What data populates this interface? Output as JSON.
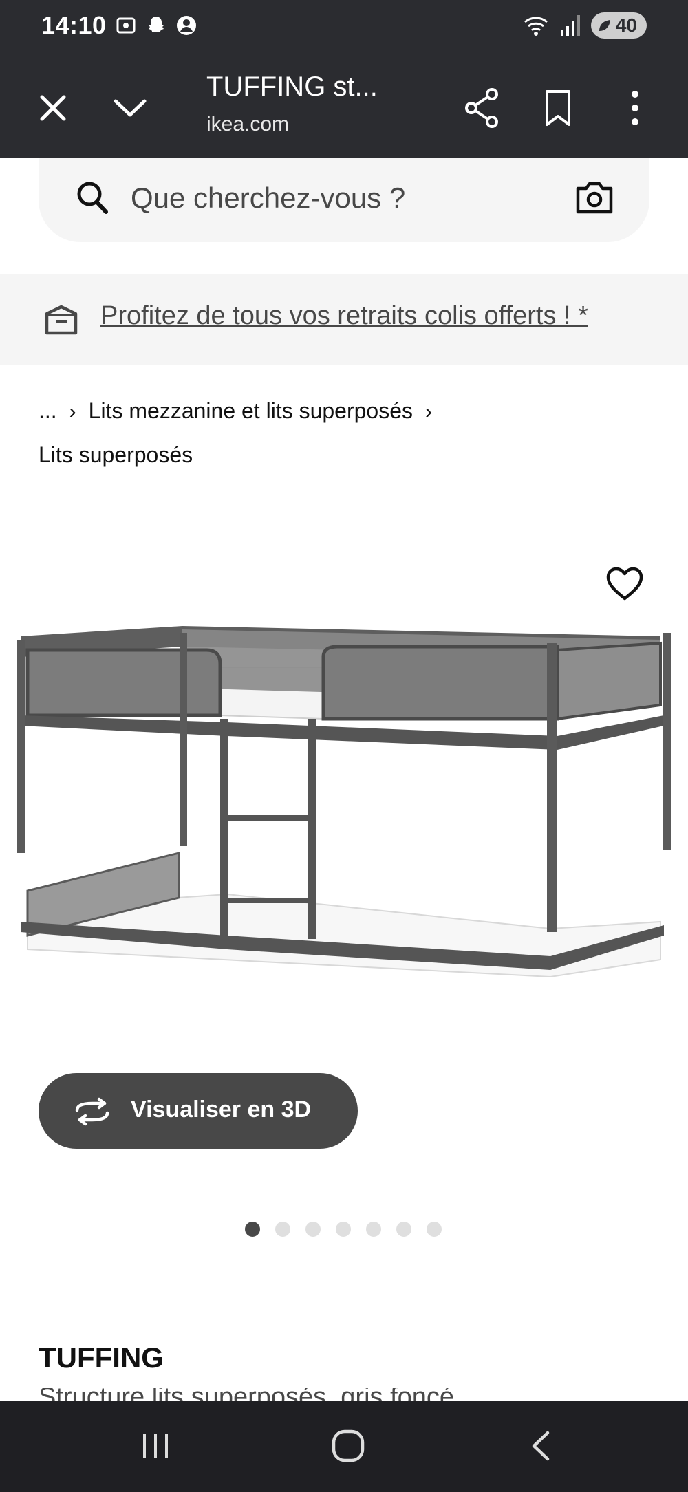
{
  "status_bar": {
    "time": "14:10",
    "battery": "40",
    "icons_left": [
      "screen-record-icon",
      "snapchat-icon",
      "account-icon"
    ],
    "icons_right": [
      "wifi-icon",
      "signal-icon",
      "battery-icon"
    ]
  },
  "browser": {
    "title": "TUFFING st...",
    "url": "ikea.com",
    "close_icon": "close-icon",
    "collapse_icon": "chevron-down-icon",
    "share_icon": "share-icon",
    "bookmark_icon": "bookmark-icon",
    "menu_icon": "more-vert-icon"
  },
  "search": {
    "placeholder": "Que cherchez-vous ?"
  },
  "promo": {
    "text": "Profitez de tous vos retraits colis offerts ! *"
  },
  "breadcrumb": {
    "items": [
      "...",
      "Lits mezzanine et lits superposés",
      "Lits superposés"
    ]
  },
  "product": {
    "image_alt": "Lit superposé TUFFING",
    "viz3d_label": "Visualiser en 3D",
    "carousel": {
      "count": 7,
      "active": 1
    },
    "name": "TUFFING",
    "subtitle": "Structure lits superposés, gris foncé"
  },
  "colors": {
    "bar_dark": "#2b2c30",
    "button_dark": "#484848",
    "light_bg": "#f5f5f5"
  }
}
